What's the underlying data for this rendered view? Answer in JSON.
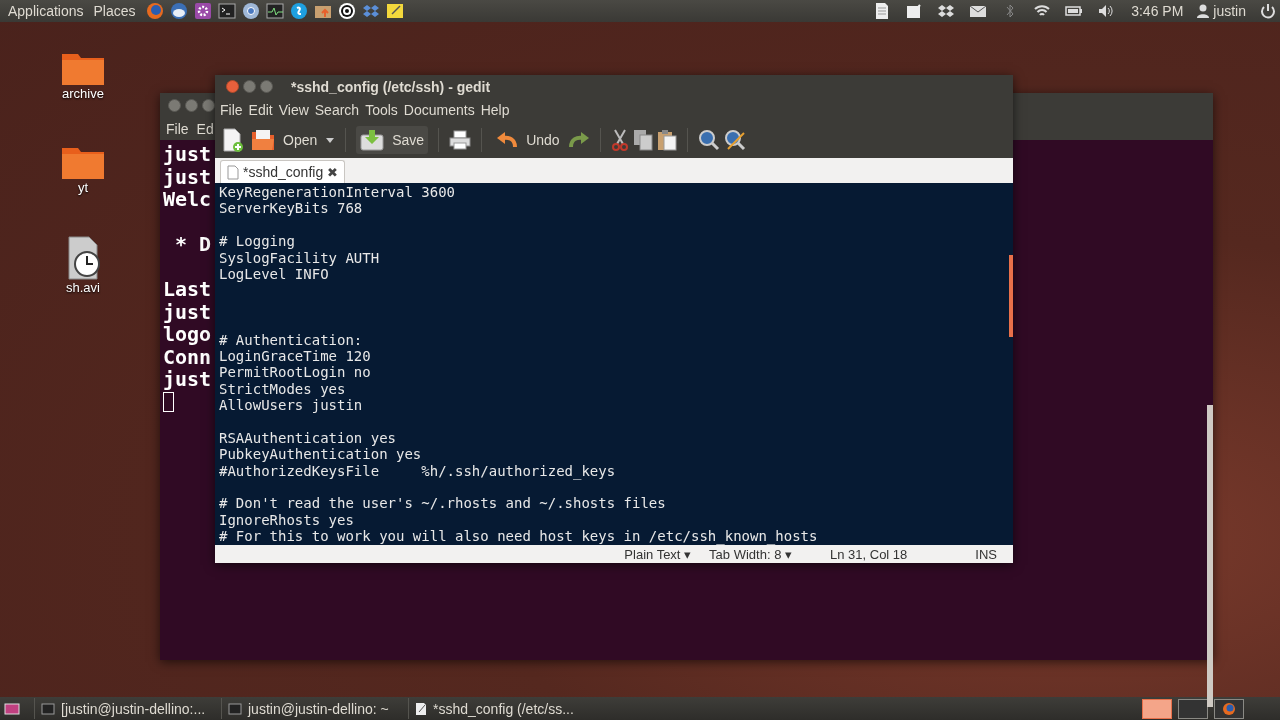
{
  "top_panel": {
    "menus": [
      "Applications",
      "Places"
    ],
    "clock": "3:46 PM",
    "user": "justin"
  },
  "desktop_icons": [
    {
      "label": "archive",
      "kind": "folder"
    },
    {
      "label": "yt",
      "kind": "folder"
    },
    {
      "label": "sh.avi",
      "kind": "video"
    }
  ],
  "terminal_window": {
    "menu": [
      "File",
      "Ed"
    ],
    "blocks": [
      {
        "kind": "top",
        "lines": [
          "just",
          "just",
          "Welc"
        ]
      },
      {
        "kind": "normal",
        "lines": [
          " * D"
        ]
      },
      {
        "kind": "normal",
        "lines": [
          "Last",
          "just",
          "logo",
          "Conn",
          "just"
        ]
      }
    ]
  },
  "gedit_window": {
    "title": "*sshd_config (/etc/ssh) - gedit",
    "menu": [
      "File",
      "Edit",
      "View",
      "Search",
      "Tools",
      "Documents",
      "Help"
    ],
    "toolbar": [
      {
        "kind": "new"
      },
      {
        "kind": "open",
        "label": "Open"
      },
      {
        "kind": "dropdown"
      },
      {
        "kind": "sep"
      },
      {
        "kind": "save",
        "label": "Save"
      },
      {
        "kind": "sep"
      },
      {
        "kind": "print"
      },
      {
        "kind": "sep"
      },
      {
        "kind": "undo",
        "label": "Undo"
      },
      {
        "kind": "redo"
      },
      {
        "kind": "sep"
      },
      {
        "kind": "cut"
      },
      {
        "kind": "copy"
      },
      {
        "kind": "paste"
      },
      {
        "kind": "sep"
      },
      {
        "kind": "find"
      },
      {
        "kind": "replace"
      }
    ],
    "tab": {
      "label": "*sshd_config",
      "close": "✖"
    },
    "blocks": [
      {
        "kind": "top",
        "lines": [
          "KeyRegenerationInterval 3600",
          "ServerKeyBits 768"
        ]
      },
      {
        "kind": "normal",
        "lines": [
          "# Logging",
          "SyslogFacility AUTH",
          "LogLevel INFO"
        ]
      },
      {
        "kind": "wide",
        "lines": [
          "# Authentication:",
          "LoginGraceTime 120",
          "PermitRootLogin no",
          "StrictModes yes",
          "AllowUsers justin"
        ]
      },
      {
        "kind": "normal",
        "lines": [
          "RSAAuthentication yes",
          "PubkeyAuthentication yes",
          "#AuthorizedKeysFile     %h/.ssh/authorized_keys"
        ]
      },
      {
        "kind": "normal",
        "lines": [
          "# Don't read the user's ~/.rhosts and ~/.shosts files",
          "IgnoreRhosts yes",
          "# For this to work you will also need host keys in /etc/ssh_known_hosts"
        ]
      }
    ],
    "status": {
      "language": "Plain Text ▾",
      "tab_width": "Tab Width: 8 ▾",
      "position": "Ln 31, Col 18",
      "mode": "INS"
    }
  },
  "taskbar": {
    "tasks": [
      {
        "label": "[justin@justin-dellino:...",
        "kind": "terminal"
      },
      {
        "label": "justin@justin-dellino: ~",
        "kind": "terminal"
      },
      {
        "label": "*sshd_config (/etc/ss...",
        "kind": "editor"
      }
    ],
    "workspaces": [
      {
        "selected": true,
        "kind": "plain"
      },
      {
        "selected": false,
        "kind": "plain"
      },
      {
        "selected": false,
        "kind": "browser"
      }
    ]
  }
}
